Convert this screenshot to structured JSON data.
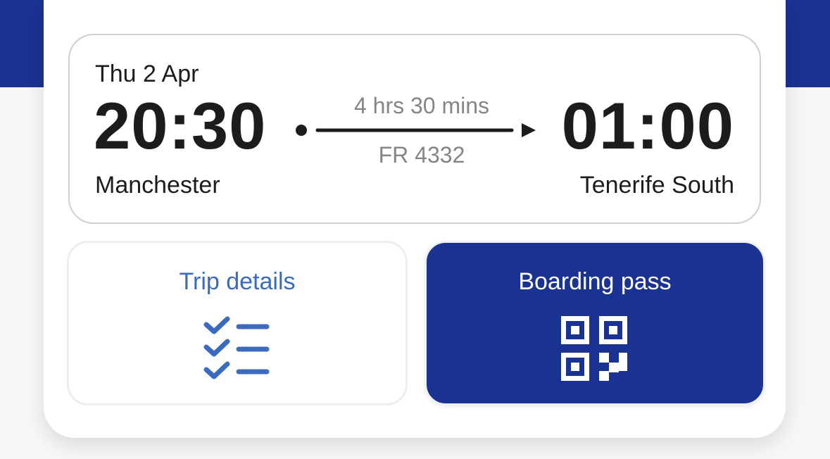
{
  "flight": {
    "date": "Thu 2 Apr",
    "departure_time": "20:30",
    "departure_city": "Manchester",
    "arrival_time": "01:00",
    "arrival_city": "Tenerife South",
    "duration": "4 hrs 30 mins",
    "flight_number": "FR 4332"
  },
  "actions": {
    "trip_details_label": "Trip details",
    "trip_details_icon": "checklist-icon",
    "boarding_pass_label": "Boarding pass",
    "boarding_pass_icon": "qr-code-icon"
  },
  "colors": {
    "brand_blue": "#1a3291",
    "link_blue": "#3a6bbf",
    "muted_text": "#858585"
  }
}
